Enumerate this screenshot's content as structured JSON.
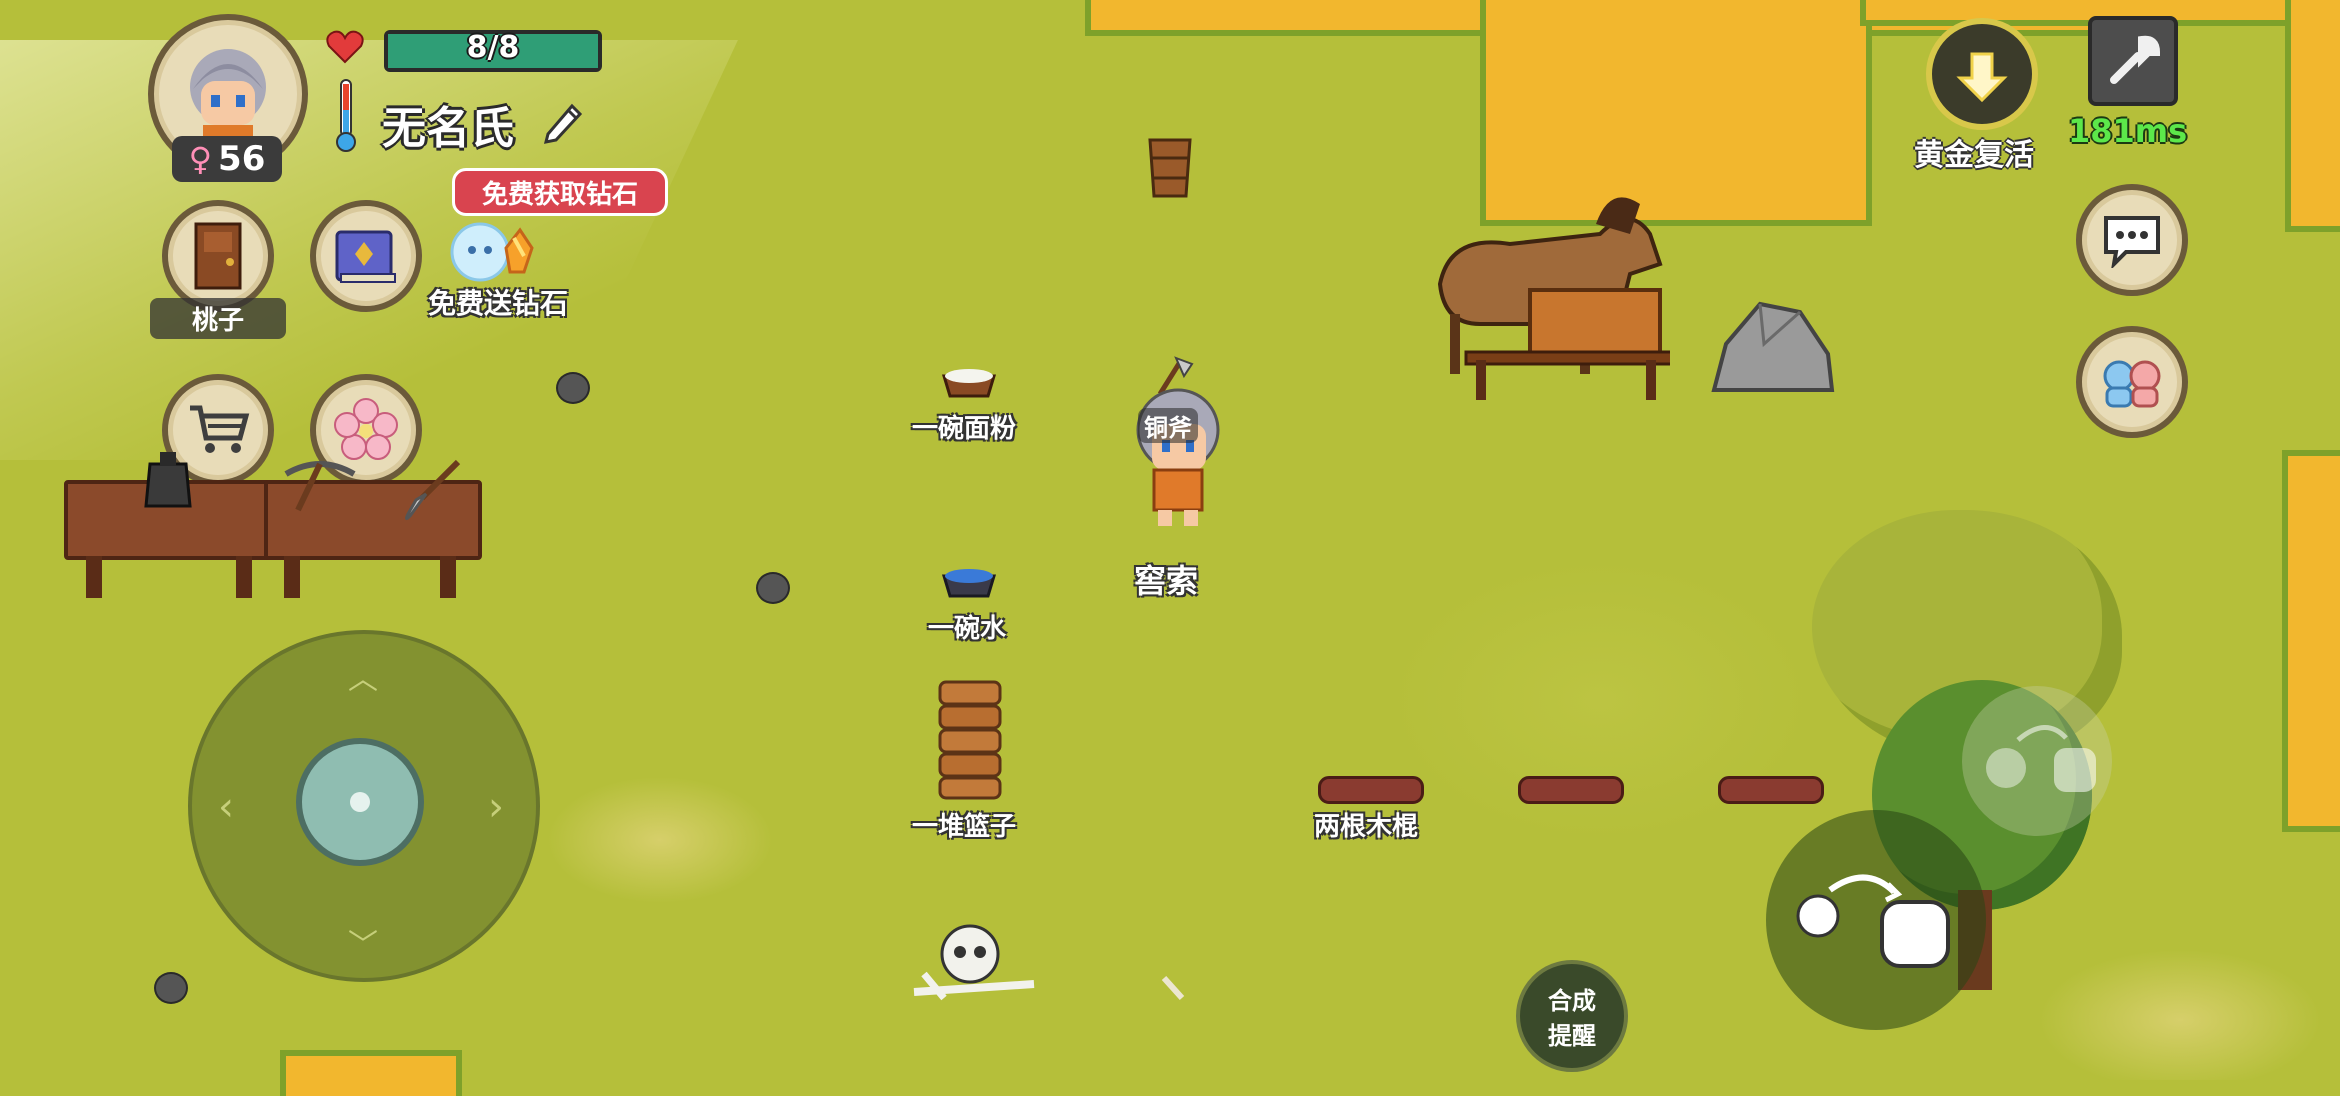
{
  "player": {
    "health_text": "8/8",
    "health_fraction": 1.0,
    "name": "无名氏",
    "gender_symbol": "♀",
    "age": "56",
    "character_label": "窖索",
    "held_tool_label": "铜斧"
  },
  "promo": {
    "bubble_text": "免费获取钻石",
    "gift_label": "免费送钻石"
  },
  "left_buttons": {
    "door_label": "桃子"
  },
  "top_right": {
    "revive_label": "黄金复活",
    "ping_text": "181ms"
  },
  "items": {
    "flour_bowl": "一碗面粉",
    "water_bowl": "一碗水",
    "basket_stack": "一堆篮子",
    "two_sticks": "两根木棍"
  },
  "craft_button": {
    "line1": "合成",
    "line2": "提醒"
  },
  "colors": {
    "grass": "#b5bf3a",
    "sand": "#f2b72e",
    "health_bar": "#2f9e76",
    "promo_bubble": "#d9444f",
    "ping_green": "#5ce84a"
  },
  "icons": {
    "heart": "heart-icon",
    "thermometer": "thermometer-icon",
    "edit": "pencil-icon",
    "settings": "wrench-icon",
    "chat": "chat-icon",
    "friends": "friends-icon",
    "shop": "shopping-cart-icon",
    "flower": "sakura-flower-icon",
    "book": "book-icon",
    "door": "door-icon"
  }
}
